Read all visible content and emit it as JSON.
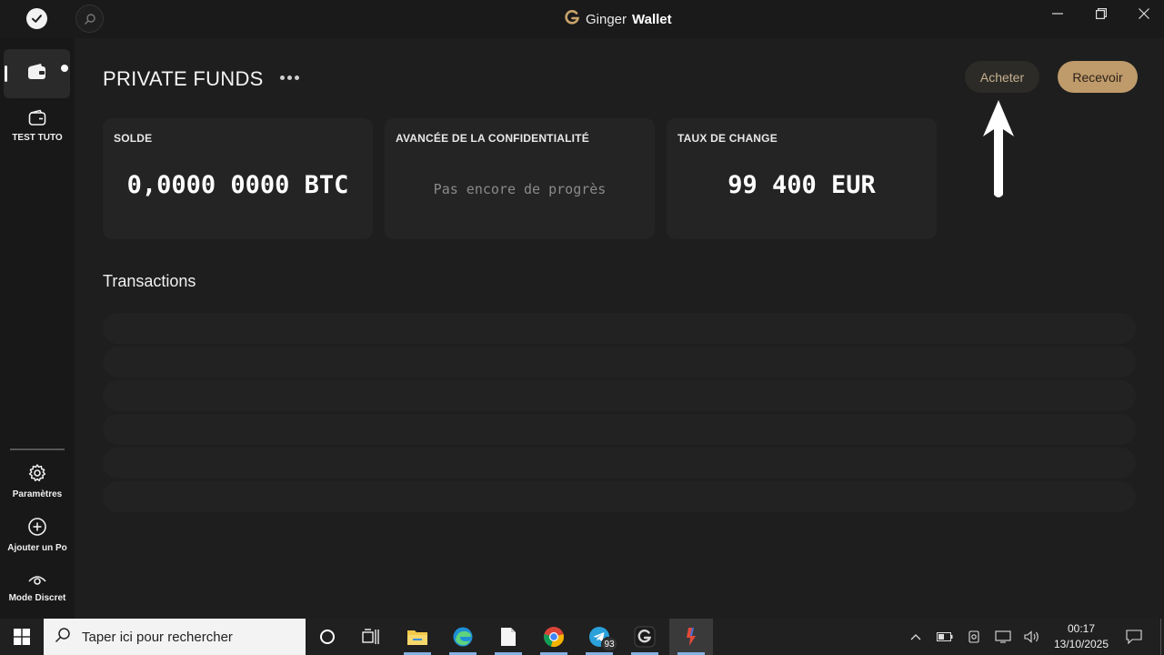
{
  "app": {
    "title_light": "Ginger",
    "title_bold": "Wallet"
  },
  "sidebar": {
    "wallets": [
      {
        "label": "",
        "active": true
      },
      {
        "label": "TEST TUTO",
        "active": false
      }
    ],
    "bottom": [
      {
        "label": "Paramètres",
        "icon": "gear-icon"
      },
      {
        "label": "Ajouter un Po",
        "icon": "plus-circle-icon"
      },
      {
        "label": "Mode Discret",
        "icon": "eye-icon"
      }
    ]
  },
  "header": {
    "title": "PRIVATE FUNDS",
    "buy_label": "Acheter",
    "receive_label": "Recevoir"
  },
  "cards": [
    {
      "label": "SOLDE",
      "value": "0,0000 0000 BTC"
    },
    {
      "label": "AVANCÉE DE LA CONFIDENTIALITÉ",
      "value": "Pas encore de progrès"
    },
    {
      "label": "TAUX DE CHANGE",
      "value": "99 400 EUR"
    }
  ],
  "transactions": {
    "title": "Transactions",
    "placeholder_rows": 6
  },
  "taskbar": {
    "search_placeholder": "Taper ici pour rechercher",
    "telegram_badge": "93",
    "time": "00:17",
    "date": "13/10/2025"
  },
  "colors": {
    "accent_gold": "#bf9a6a",
    "buy_text": "#c7b08f",
    "background": "#1e1e1e"
  }
}
